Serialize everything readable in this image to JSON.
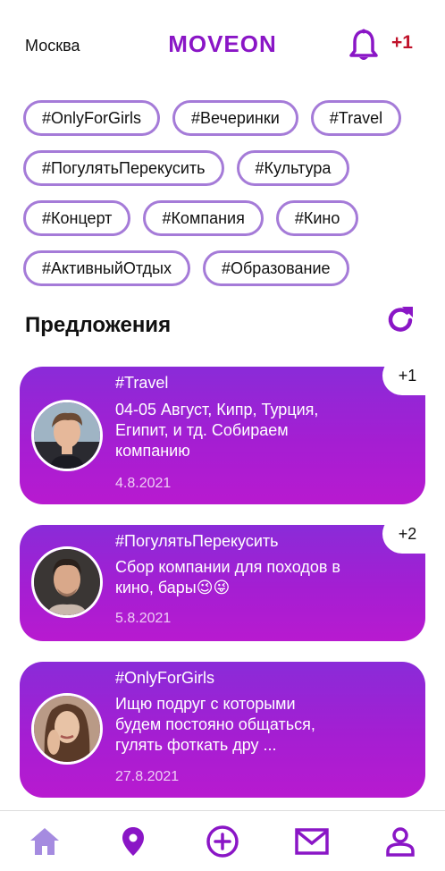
{
  "header": {
    "city": "Москва",
    "logo": "MOVEON",
    "notification_count": "+1",
    "bell_icon": "bell-icon"
  },
  "tags": [
    [
      "#OnlyForGirls",
      "#Вечеринки",
      "#Travel"
    ],
    [
      "#ПогулятьПерекусить",
      "#Культура"
    ],
    [
      "#Концерт",
      "#Компания",
      "#Кино"
    ],
    [
      "#АктивныйОтдых",
      "#Образование"
    ]
  ],
  "suggestions": {
    "title": "Предложения",
    "refresh_icon": "refresh-icon",
    "cards": [
      {
        "tag": "#Travel",
        "text": "04-05 Август, Кипр, Турция, Египит, и тд. Собираем компанию",
        "date": "4.8.2021",
        "badge": "+1"
      },
      {
        "tag": "#ПогулятьПерекусить",
        "text": "Сбор компании для походов в кино, бары😉😜",
        "date": "5.8.2021",
        "badge": "+2"
      },
      {
        "tag": "#OnlyForGirls",
        "text": "Ищю подруг с которыми будем постояно общаться, гулять фоткать дру ...",
        "date": "27.8.2021",
        "badge": ""
      }
    ]
  },
  "bottom_nav": {
    "items": [
      "home-icon",
      "location-pin-icon",
      "add-circle-icon",
      "mail-icon",
      "profile-icon"
    ],
    "active": "home-icon",
    "colors": {
      "active": "#a58be0",
      "inactive": "#8a16c6"
    }
  },
  "colors": {
    "brand": "#8a16c6",
    "tag_border": "#a57bd8",
    "notification": "#c0122a",
    "card_gradient_top": "#8a2bd8",
    "card_gradient_bottom": "#b81ad0"
  }
}
